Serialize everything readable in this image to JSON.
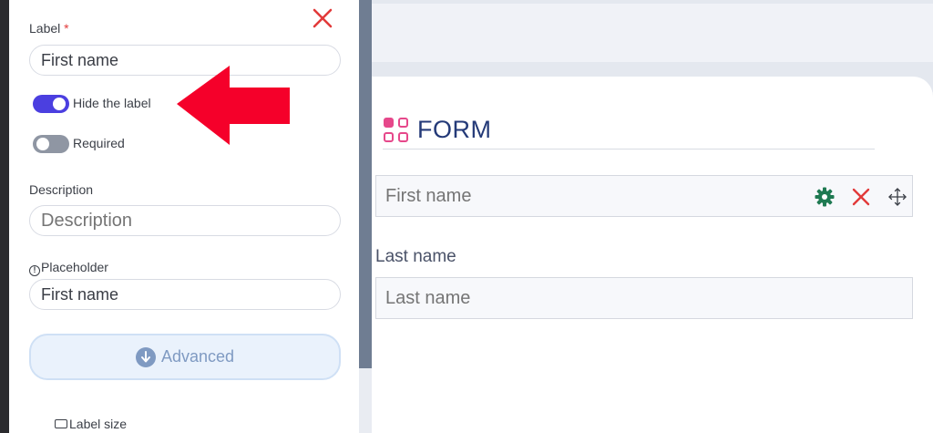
{
  "panel": {
    "label_field": {
      "label": "Label",
      "required_mark": "*",
      "value": "First name"
    },
    "hide_label_toggle": {
      "label": "Hide the label",
      "state": "on"
    },
    "required_toggle": {
      "label": "Required",
      "state": "off"
    },
    "description_field": {
      "label": "Description",
      "placeholder": "Description"
    },
    "placeholder_field": {
      "label": "Placeholder",
      "value": "First name"
    },
    "advanced_button": {
      "label": "Advanced"
    },
    "label_size": {
      "label": "Label size"
    }
  },
  "form": {
    "title": "FORM",
    "fields": [
      {
        "placeholder": "First name"
      },
      {
        "label": "Last name",
        "placeholder": "Last name"
      }
    ]
  },
  "icons": {
    "close": "close-icon",
    "settings": "gear-icon",
    "delete": "close-icon",
    "move": "move-icon",
    "form": "form-grid-icon",
    "advanced": "arrow-down-circle-icon"
  },
  "colors": {
    "accent": "#4b3fe0",
    "danger": "#e23a3a",
    "form_title": "#243a78",
    "gear": "#1f7a52",
    "annotation_arrow": "#f5002a"
  }
}
